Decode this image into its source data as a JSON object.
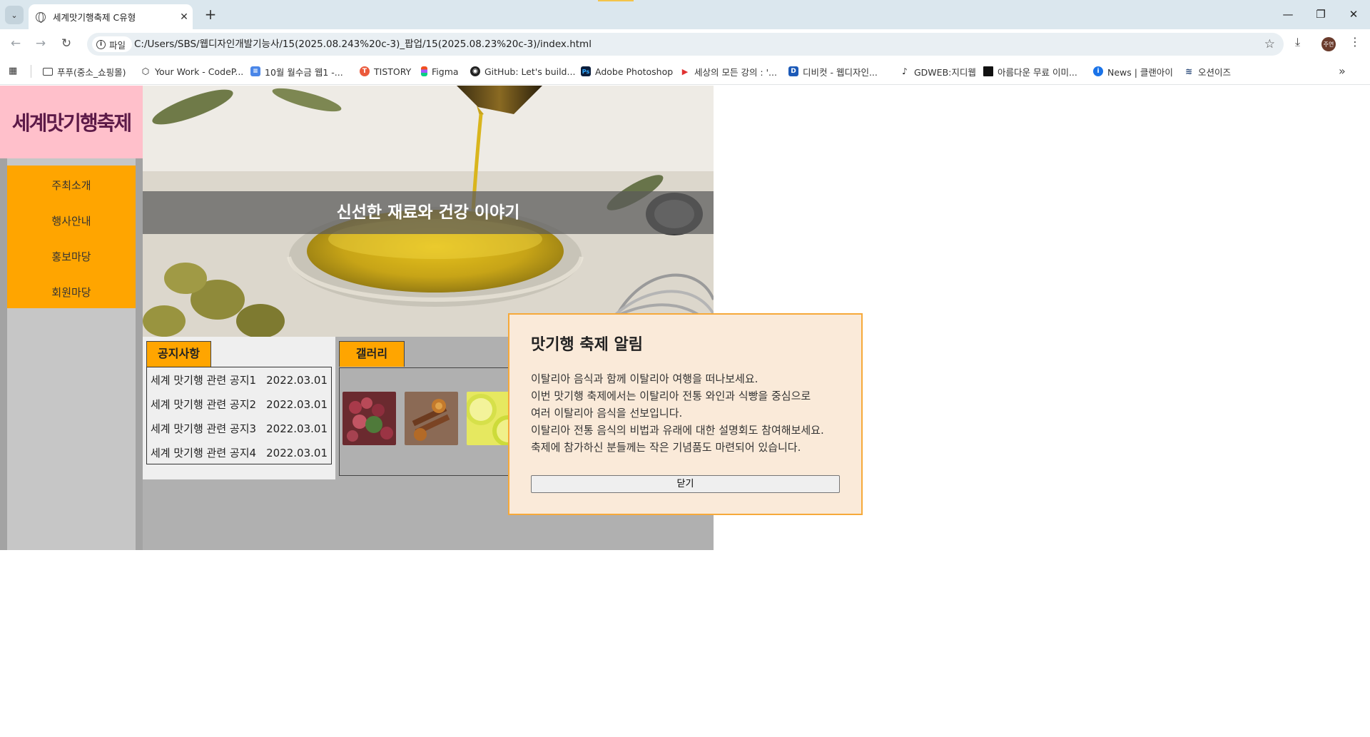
{
  "browser": {
    "tab_title": "세계맛기행축제 C유형",
    "address_scheme": "파일",
    "address_url": "C:/Users/SBS/웹디자인개발기능사/15(2025.08.243%20c-3)_팝업/15(2025.08.23%20c-3)/index.html",
    "profile_initials": "주연",
    "bookmarks": [
      {
        "label": "푸푸(중소_쇼핑몰)",
        "icon": "folder-icon"
      },
      {
        "label": "Your Work - CodeP...",
        "icon": "codepen-icon"
      },
      {
        "label": "10월 월수금 웹1 -...",
        "icon": "docs-icon"
      },
      {
        "label": "TISTORY",
        "icon": "tistory-icon"
      },
      {
        "label": "Figma",
        "icon": "figma-icon"
      },
      {
        "label": "GitHub: Let's build...",
        "icon": "github-icon"
      },
      {
        "label": "Adobe Photoshop",
        "icon": "photoshop-icon"
      },
      {
        "label": "세상의 모든 강의 : '...",
        "icon": "play-icon"
      },
      {
        "label": "디비컷 - 웹디자인...",
        "icon": "dbcut-icon"
      },
      {
        "label": "GDWEB:지디웹",
        "icon": "gdweb-icon"
      },
      {
        "label": "아름다운 무료 이미...",
        "icon": "unsplash-icon"
      },
      {
        "label": "News | 클랜아이",
        "icon": "info-icon"
      },
      {
        "label": "오션이즈",
        "icon": "oceanis-icon"
      }
    ]
  },
  "site": {
    "logo": "세계맛기행축제",
    "nav": [
      "주최소개",
      "행사안내",
      "홍보마당",
      "회원마당"
    ],
    "slide_caption": "신선한 재료와 건강 이야기",
    "notice": {
      "tab_label": "공지사항",
      "items": [
        {
          "title": "세계 맛기행 관련 공지1",
          "date": "2022.03.01"
        },
        {
          "title": "세계 맛기행 관련 공지2",
          "date": "2022.03.01"
        },
        {
          "title": "세계 맛기행 관련 공지3",
          "date": "2022.03.01"
        },
        {
          "title": "세계 맛기행 관련 공지4",
          "date": "2022.03.01"
        }
      ]
    },
    "gallery": {
      "tab_label": "갤러리",
      "thumbs": [
        "gallery-grapes-image",
        "gallery-spices-image",
        "gallery-lemon-image"
      ]
    }
  },
  "popup": {
    "title": "맛기행 축제 알림",
    "lines": [
      "이탈리아 음식과 함께 이탈리아 여행을 떠나보세요.",
      "이번 맛기행 축제에서는 이탈리아 전통 와인과 식빵을 중심으로",
      "여러 이탈리아 음식을 선보입니다.",
      "이탈리아 전통 음식의 비법과 유래에 대한 설명회도 참여해보세요.",
      "축제에 참가하신 분들께는 작은 기념품도 마련되어 있습니다."
    ],
    "close_label": "닫기"
  },
  "colors": {
    "logo_bg": "#ffc0cb",
    "nav_bg": "#ffa500",
    "popup_bg": "#faead9",
    "popup_border": "#f6a93a"
  }
}
